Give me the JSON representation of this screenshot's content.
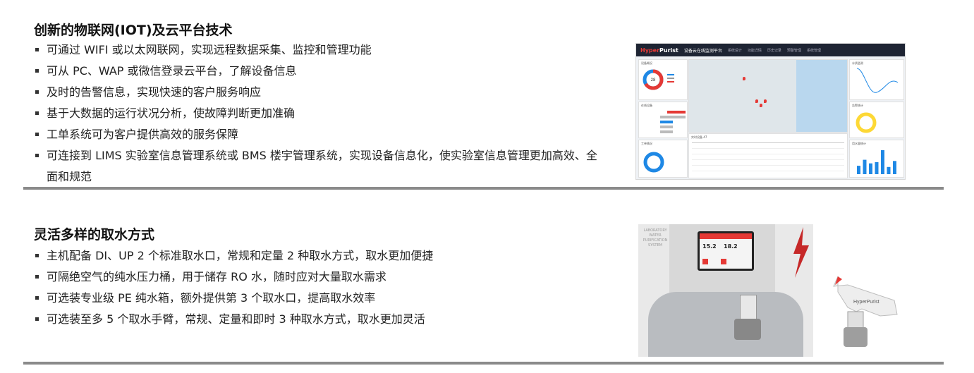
{
  "section1": {
    "heading": "创新的物联网(IOT)及云平台技术",
    "bullets": [
      "可通过 WIFI 或以太网联网，实现远程数据采集、监控和管理功能",
      "可从 PC、WAP 或微信登录云平台，了解设备信息",
      "及时的告警信息，实现快速的客户服务响应",
      "基于大数据的运行状况分析，使故障判断更加准确",
      "工单系统可为客户提供高效的服务保障",
      "可连接到 LIMS 实验室信息管理系统或 BMS 楼宇管理系统，实现设备信息化，使实验室信息管理更加高效、全面和规范"
    ]
  },
  "dashboard": {
    "logo_brand": "Hyper",
    "logo_rest": "Purist",
    "title": "设备云在线监测平台",
    "nav": [
      "系统设计",
      "功能详情",
      "历史记录",
      "预警管理",
      "系统管理"
    ],
    "panels": {
      "device_overview": "设备概况",
      "online_devices": "在线设备",
      "work_orders": "工单情况",
      "device_list": "实时设备 47",
      "water_quality": "水质监测",
      "alarm_stats": "告警统计",
      "usage": "用水量统计"
    },
    "donut_value": "28",
    "colors": {
      "accent": "#e53935",
      "blue": "#1e88e5",
      "yellow": "#fdd835",
      "navy": "#1e2433"
    },
    "bars": [
      0.35,
      0.6,
      0.45,
      0.5,
      1.0,
      0.3,
      0.55
    ]
  },
  "section2": {
    "heading": "灵活多样的取水方式",
    "bullets": [
      "主机配备 DI、UP 2 个标准取水口，常规和定量 2 种取水方式，取水更加便捷",
      "可隔绝空气的纯水压力桶，用于储存 RO 水，随时应对大量取水需求",
      "可选装专业级 PE 纯水箱，额外提供第 3 个取水口，提高取水效率",
      "可选装至多 5 个取水手臂，常规、定量和即时 3 种取水方式，取水更加灵活"
    ]
  },
  "product": {
    "side_text": [
      "LABORATORY",
      "WATER",
      "PURIFICATION",
      "SYSTEM"
    ],
    "screen_values": [
      "15.2",
      "18.2"
    ],
    "arm_brand": "HyperPurist"
  }
}
